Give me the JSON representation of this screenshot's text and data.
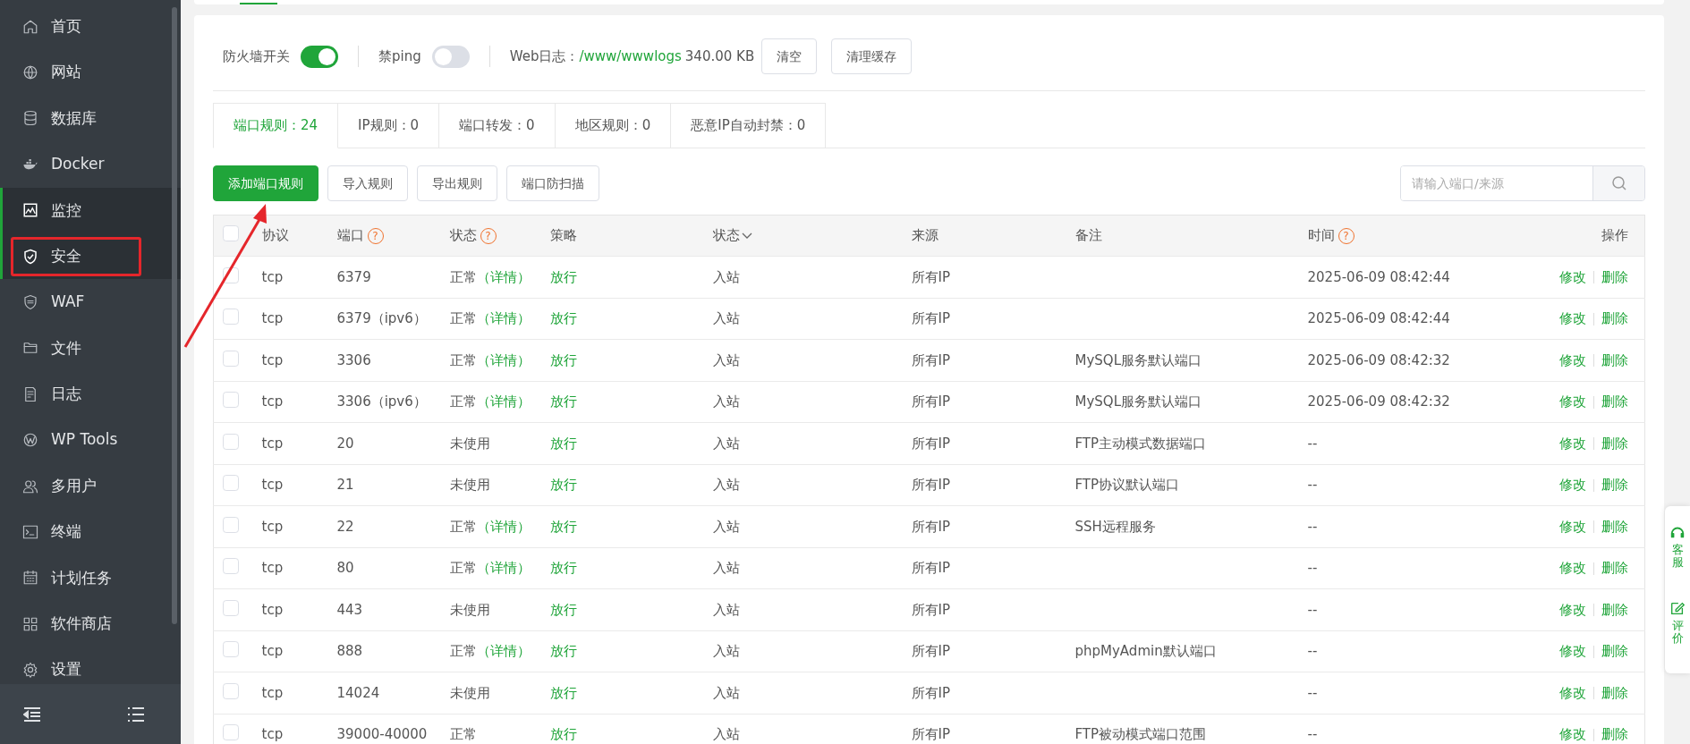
{
  "sidebar": {
    "items": [
      {
        "label": "首页",
        "selected": false,
        "highlighted": false
      },
      {
        "label": "网站",
        "selected": false,
        "highlighted": false
      },
      {
        "label": "数据库",
        "selected": false,
        "highlighted": false
      },
      {
        "label": "Docker",
        "selected": false,
        "highlighted": false
      },
      {
        "label": "监控",
        "selected": true,
        "highlighted": false
      },
      {
        "label": "安全",
        "selected": true,
        "highlighted": true
      },
      {
        "label": "WAF",
        "selected": false,
        "highlighted": false
      },
      {
        "label": "文件",
        "selected": false,
        "highlighted": false
      },
      {
        "label": "日志",
        "selected": false,
        "highlighted": false
      },
      {
        "label": "WP Tools",
        "selected": false,
        "highlighted": false
      },
      {
        "label": "多用户",
        "selected": false,
        "highlighted": false
      },
      {
        "label": "终端",
        "selected": false,
        "highlighted": false
      },
      {
        "label": "计划任务",
        "selected": false,
        "highlighted": false
      },
      {
        "label": "软件商店",
        "selected": false,
        "highlighted": false
      },
      {
        "label": "设置",
        "selected": false,
        "highlighted": false
      }
    ]
  },
  "toolbar": {
    "firewall": {
      "label": "防火墙开关",
      "on": true
    },
    "ping": {
      "label": "禁ping",
      "on": false
    },
    "web_log": {
      "label": "Web日志：",
      "path": "/www/wwwlogs",
      "size": "340.00 KB"
    },
    "buttons": [
      "清空",
      "清理缓存"
    ]
  },
  "tabs": [
    {
      "label": "端口规则：24",
      "selected": true
    },
    {
      "label": "IP规则：0",
      "selected": false
    },
    {
      "label": "端口转发：0",
      "selected": false
    },
    {
      "label": "地区规则：0",
      "selected": false
    },
    {
      "label": "恶意IP自动封禁：0",
      "selected": false
    }
  ],
  "actions": [
    {
      "label": "添加端口规则",
      "primary": true,
      "arrow": true
    },
    {
      "label": "导入规则",
      "primary": false,
      "arrow": false
    },
    {
      "label": "导出规则",
      "primary": false,
      "arrow": false
    },
    {
      "label": "端口防扫描",
      "primary": false,
      "arrow": false
    }
  ],
  "search": {
    "placeholder": "请输入端口/来源"
  },
  "table": {
    "select_all": {
      "checked": false
    },
    "columns": [
      {
        "label": "协议"
      },
      {
        "label": "端口",
        "help": "?"
      },
      {
        "label": "状态",
        "help": "?"
      },
      {
        "label": "策略"
      },
      {
        "label": "状态",
        "dropdown": true
      },
      {
        "label": "来源"
      },
      {
        "label": "备注"
      },
      {
        "label": "时间",
        "help": "?"
      },
      {
        "label": "操作"
      }
    ],
    "rows": [
      {
        "checked": false,
        "protocol": "tcp",
        "port": "6379",
        "status": "正常",
        "detail": "（详情）",
        "policy": "放行",
        "direction": "入站",
        "source": "所有IP",
        "note": "",
        "time": "2025-06-09 08:42:44",
        "actions": [
          "修改",
          "删除"
        ]
      },
      {
        "checked": false,
        "protocol": "tcp",
        "port": "6379（ipv6）",
        "status": "正常",
        "detail": "（详情）",
        "policy": "放行",
        "direction": "入站",
        "source": "所有IP",
        "note": "",
        "time": "2025-06-09 08:42:44",
        "actions": [
          "修改",
          "删除"
        ]
      },
      {
        "checked": false,
        "protocol": "tcp",
        "port": "3306",
        "status": "正常",
        "detail": "（详情）",
        "policy": "放行",
        "direction": "入站",
        "source": "所有IP",
        "note": "MySQL服务默认端口",
        "time": "2025-06-09 08:42:32",
        "actions": [
          "修改",
          "删除"
        ]
      },
      {
        "checked": false,
        "protocol": "tcp",
        "port": "3306（ipv6）",
        "status": "正常",
        "detail": "（详情）",
        "policy": "放行",
        "direction": "入站",
        "source": "所有IP",
        "note": "MySQL服务默认端口",
        "time": "2025-06-09 08:42:32",
        "actions": [
          "修改",
          "删除"
        ]
      },
      {
        "checked": false,
        "protocol": "tcp",
        "port": "20",
        "status": "未使用",
        "detail": "",
        "policy": "放行",
        "direction": "入站",
        "source": "所有IP",
        "note": "FTP主动模式数据端口",
        "time": "--",
        "actions": [
          "修改",
          "删除"
        ]
      },
      {
        "checked": false,
        "protocol": "tcp",
        "port": "21",
        "status": "未使用",
        "detail": "",
        "policy": "放行",
        "direction": "入站",
        "source": "所有IP",
        "note": "FTP协议默认端口",
        "time": "--",
        "actions": [
          "修改",
          "删除"
        ]
      },
      {
        "checked": false,
        "protocol": "tcp",
        "port": "22",
        "status": "正常",
        "detail": "（详情）",
        "policy": "放行",
        "direction": "入站",
        "source": "所有IP",
        "note": "SSH远程服务",
        "time": "--",
        "actions": [
          "修改",
          "删除"
        ]
      },
      {
        "checked": false,
        "protocol": "tcp",
        "port": "80",
        "status": "正常",
        "detail": "（详情）",
        "policy": "放行",
        "direction": "入站",
        "source": "所有IP",
        "note": "",
        "time": "--",
        "actions": [
          "修改",
          "删除"
        ]
      },
      {
        "checked": false,
        "protocol": "tcp",
        "port": "443",
        "status": "未使用",
        "detail": "",
        "policy": "放行",
        "direction": "入站",
        "source": "所有IP",
        "note": "",
        "time": "--",
        "actions": [
          "修改",
          "删除"
        ]
      },
      {
        "checked": false,
        "protocol": "tcp",
        "port": "888",
        "status": "正常",
        "detail": "（详情）",
        "policy": "放行",
        "direction": "入站",
        "source": "所有IP",
        "note": "phpMyAdmin默认端口",
        "time": "--",
        "actions": [
          "修改",
          "删除"
        ]
      },
      {
        "checked": false,
        "protocol": "tcp",
        "port": "14024",
        "status": "未使用",
        "detail": "",
        "policy": "放行",
        "direction": "入站",
        "source": "所有IP",
        "note": "",
        "time": "--",
        "actions": [
          "修改",
          "删除"
        ]
      },
      {
        "checked": false,
        "protocol": "tcp",
        "port": "39000-40000",
        "status": "正常",
        "detail": "",
        "policy": "放行",
        "direction": "入站",
        "source": "所有IP",
        "note": "FTP被动模式端口范围",
        "time": "--",
        "actions": [
          "修改",
          "删除"
        ]
      }
    ]
  },
  "float_panel": {
    "items": [
      {
        "label": "客服"
      },
      {
        "label": "评价"
      }
    ]
  }
}
